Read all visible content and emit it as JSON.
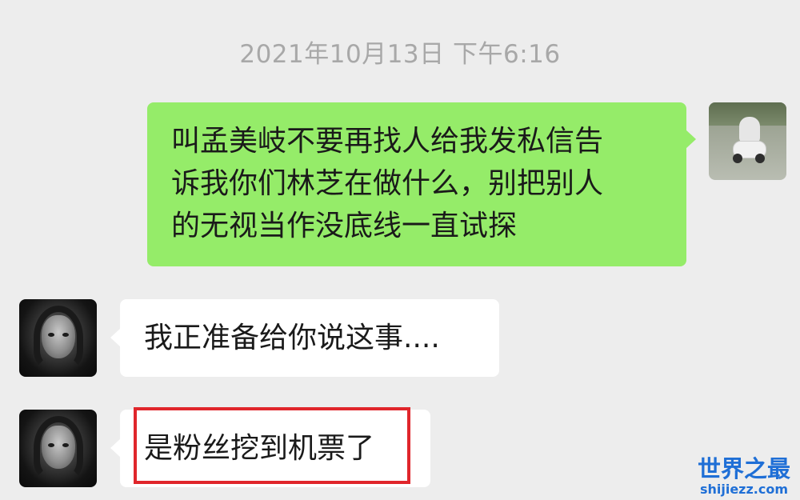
{
  "chat": {
    "timestamp": "2021年10月13日 下午6:16",
    "messages": [
      {
        "sender": "self",
        "text": "叫孟美岐不要再找人给我发私信告诉我你们林芝在做什么，别把别人的无视当作没底线一直试探",
        "lines": [
          "叫孟美岐不要再找人给我发私信告",
          "诉我你们林芝在做什么，别把别人",
          "的无视当作没底线一直试探"
        ]
      },
      {
        "sender": "other",
        "text": "我正准备给你说这事...."
      },
      {
        "sender": "other",
        "text": "是粉丝挖到机票了",
        "highlighted": true
      }
    ]
  },
  "colors": {
    "background": "#ededed",
    "self_bubble": "#95ec69",
    "other_bubble": "#ffffff",
    "highlight_box": "#e0262b",
    "watermark": "#1f6fd6"
  },
  "watermark": {
    "title": "世界之最",
    "url": "shijiezz.com"
  }
}
